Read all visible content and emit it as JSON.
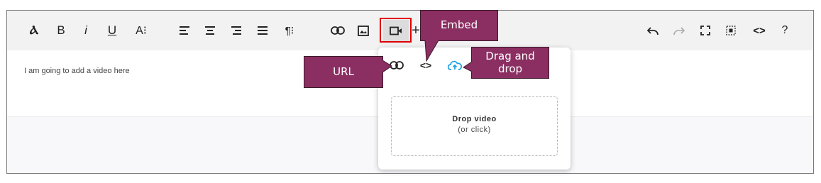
{
  "toolbar": {
    "left_buttons": [
      {
        "name": "clear-format-icon",
        "label": "Ⲁ"
      },
      {
        "name": "bold-icon",
        "label": "B"
      },
      {
        "name": "italic-icon",
        "label": "i"
      },
      {
        "name": "underline-icon",
        "label": "U"
      },
      {
        "name": "font-size-icon",
        "label": "A⁝"
      }
    ],
    "paragraph_label": "¶⁝",
    "plus_label": "+",
    "help_label": "?",
    "code_label": "<>"
  },
  "editor": {
    "text": "I am going to add a video here"
  },
  "popup": {
    "tabs": [
      "link-tab-icon",
      "code-tab-icon",
      "upload-cloud-icon"
    ],
    "drop_title": "Drop video",
    "drop_subtitle": "(or click)"
  },
  "callouts": {
    "embed": "Embed",
    "url": "URL",
    "drag_drop": "Drag and drop"
  },
  "colors": {
    "callout_bg": "#8b2f63",
    "highlight": "#e00000",
    "upload_icon": "#1fa3e6"
  }
}
